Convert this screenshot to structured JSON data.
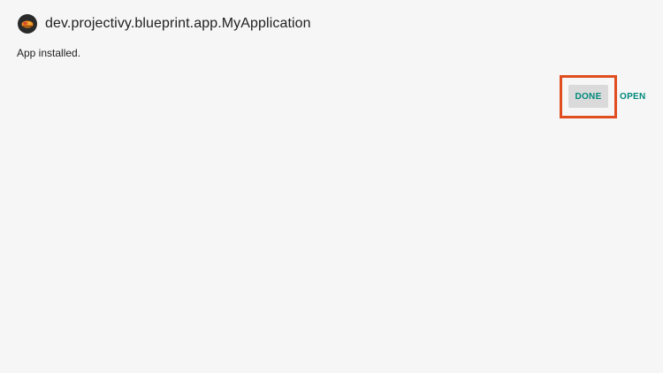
{
  "app": {
    "name": "dev.projectivy.blueprint.app.MyApplication",
    "icon": "projectivy-app-icon"
  },
  "status": {
    "message": "App installed."
  },
  "actions": {
    "done_label": "DONE",
    "open_label": "OPEN"
  },
  "colors": {
    "background": "#f6f6f6",
    "accent": "#00897b",
    "focused_button_bg": "#dadada",
    "highlight": "#e04e1f"
  }
}
